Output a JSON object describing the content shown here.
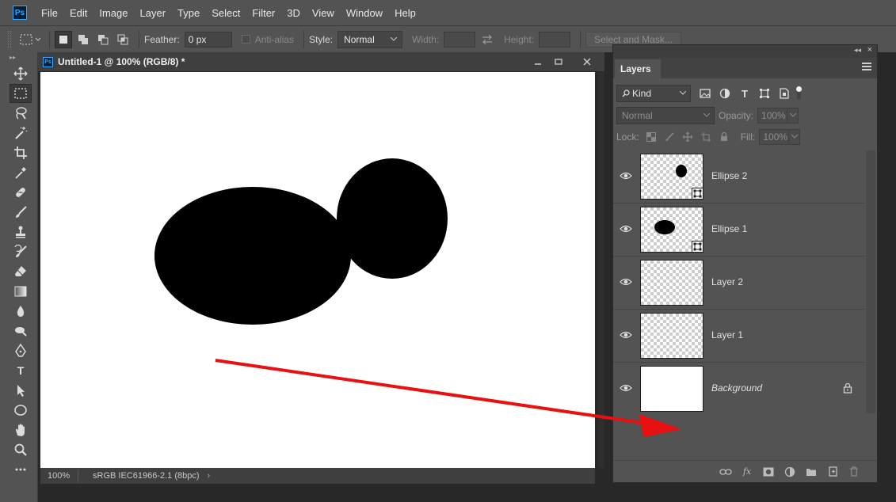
{
  "app": {
    "logo": "Ps",
    "menu": [
      "File",
      "Edit",
      "Image",
      "Layer",
      "Type",
      "Select",
      "Filter",
      "3D",
      "View",
      "Window",
      "Help"
    ]
  },
  "options": {
    "feather_label": "Feather:",
    "feather_value": "0 px",
    "antialias_label": "Anti-alias",
    "style_label": "Style:",
    "style_value": "Normal",
    "width_label": "Width:",
    "height_label": "Height:",
    "select_mask_label": "Select and Mask..."
  },
  "toolbar": {
    "icons": [
      "move-icon",
      "rect-marquee-icon",
      "lasso-icon",
      "magic-wand-icon",
      "crop-icon",
      "eyedropper-icon",
      "healing-brush-icon",
      "brush-icon",
      "clone-stamp-icon",
      "history-brush-icon",
      "eraser-icon",
      "gradient-icon",
      "blur-icon",
      "dodge-icon",
      "pen-icon",
      "type-icon",
      "path-select-icon",
      "ellipse-shape-icon",
      "hand-icon",
      "zoom-icon",
      "more-tools-icon"
    ],
    "type_tool_label": "T"
  },
  "document": {
    "title": "Untitled-1 @ 100% (RGB/8) *",
    "zoom": "100%",
    "profile": "sRGB IEC61966-2.1 (8bpc)"
  },
  "layers_panel": {
    "tab": "Layers",
    "filter_kind": "Kind",
    "blend_mode": "Normal",
    "opacity_label": "Opacity:",
    "opacity_value": "100%",
    "lock_label": "Lock:",
    "fill_label": "Fill:",
    "fill_value": "100%",
    "layers": [
      {
        "name": "Ellipse 2",
        "visible": true,
        "thumb": "ellipse2",
        "smart": true
      },
      {
        "name": "Ellipse 1",
        "visible": true,
        "thumb": "ellipse1",
        "smart": true
      },
      {
        "name": "Layer 2",
        "visible": true,
        "thumb": "transparent",
        "smart": false
      },
      {
        "name": "Layer 1",
        "visible": true,
        "thumb": "transparent",
        "smart": false
      },
      {
        "name": "Background",
        "visible": true,
        "thumb": "white",
        "locked": true
      }
    ],
    "fx_label": "fx"
  },
  "colors": {
    "ui_panel": "#535353",
    "ui_dark": "#282828",
    "accent_ps": "#31a8ff",
    "annotation_arrow": "#e81010"
  }
}
